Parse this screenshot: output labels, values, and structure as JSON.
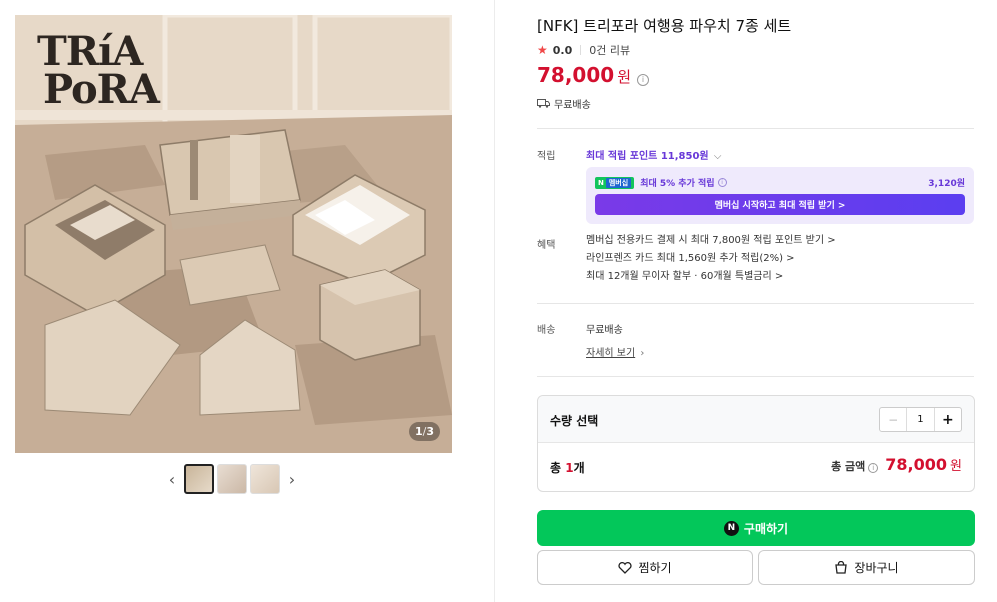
{
  "gallery": {
    "brand_line1": "TRíA",
    "brand_line2": "PoRA",
    "counter_current": "1",
    "counter_total": "3",
    "prev_arrow": "‹",
    "next_arrow": "›"
  },
  "product": {
    "title": "[NFK] 트리포라 여행용 파우치 7종 세트",
    "rating_star": "★",
    "rating_score": "0.0",
    "review_count": "0건 리뷰",
    "price": "78,000",
    "price_unit": "원",
    "shipping": "무료배송"
  },
  "points": {
    "label": "적립",
    "max_points": "최대 적립 포인트 11,850원",
    "badge_n": "N",
    "badge_plus": "멤버십",
    "extra_text": "최대 5% 추가 적립",
    "extra_amount": "3,120원",
    "membership_button": "멤버십 시작하고 최대 적립 받기 >"
  },
  "benefits": {
    "label": "혜택",
    "lines": [
      "멤버십 전용카드 결제 시 최대 7,800원 적립 포인트 받기 >",
      "라인프렌즈 카드 최대 1,560원 추가 적립(2%) >",
      "최대 12개월 무이자 할부 · 60개월 특별금리 >"
    ]
  },
  "delivery": {
    "label": "배송",
    "value": "무료배송",
    "detail_link": "자세히 보기"
  },
  "quantity": {
    "label": "수량 선택",
    "value": "1",
    "minus": "−",
    "plus": "+",
    "count_prefix": "총 ",
    "count_num": "1",
    "count_suffix": "개",
    "total_label": "총 금액",
    "total_price": "78,000",
    "total_unit": "원"
  },
  "actions": {
    "buy": "구매하기",
    "buy_icon": "N",
    "wish": "찜하기",
    "cart": "장바구니"
  }
}
